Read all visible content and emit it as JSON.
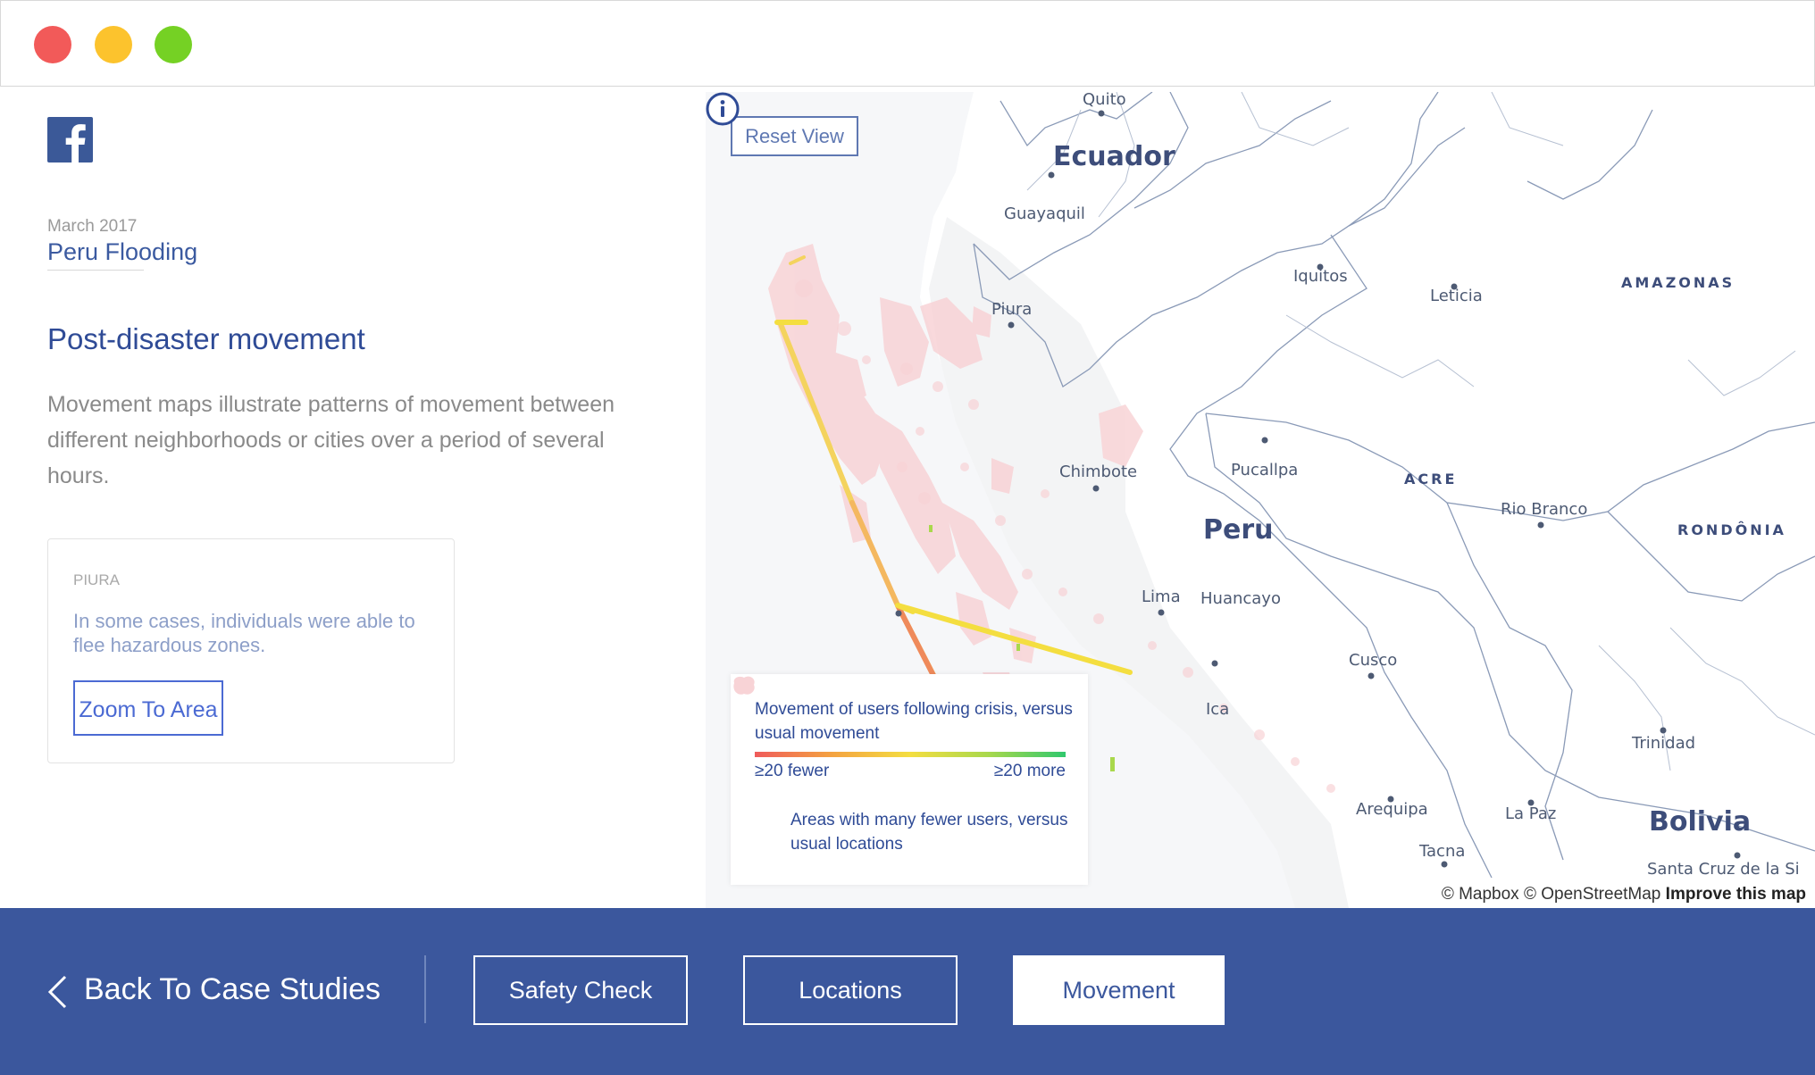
{
  "window": {
    "controls": [
      "close",
      "minimize",
      "maximize"
    ]
  },
  "sidebar": {
    "logo": "facebook-logo",
    "date": "March 2017",
    "event": "Peru Flooding",
    "section_title": "Post-disaster movement",
    "description": "Movement maps illustrate patterns of movement between different neighborhoods or cities over a period of several hours.",
    "card": {
      "kicker": "PIURA",
      "text": "In some cases, individuals were able to flee hazardous zones.",
      "button": "Zoom To Area"
    }
  },
  "map": {
    "reset_label": "Reset View",
    "info_icon": "info-icon",
    "labels": {
      "quito": "Quito",
      "ecuador": "Ecuador",
      "guayaquil": "Guayaquil",
      "iquitos": "Iquitos",
      "leticia": "Leticia",
      "amazonas": "AMAZONAS",
      "piura": "Piura",
      "chimbote": "Chimbote",
      "pucallpa": "Pucallpa",
      "acre": "ACRE",
      "rio_branco": "Rio Branco",
      "rondonia": "RONDÔNIA",
      "peru": "Peru",
      "lima": "Lima",
      "huancayo": "Huancayo",
      "cusco": "Cusco",
      "ica": "Ica",
      "trinidad": "Trinidad",
      "arequipa": "Arequipa",
      "la_paz": "La Paz",
      "bolivia": "Bolivia",
      "tacna": "Tacna",
      "santa_cruz": "Santa Cruz de la Si"
    },
    "legend": {
      "title": "Movement of users following crisis, versus usual movement",
      "left": "≥20 fewer",
      "right": "≥20 more",
      "areas": "Areas with many fewer users, versus usual locations",
      "colors": [
        "#ef5b5b",
        "#f4a340",
        "#f4de40",
        "#a9d84c",
        "#30c86d"
      ]
    },
    "attribution": {
      "mapbox": "© Mapbox",
      "osm": "© OpenStreetMap",
      "improve": "Improve this map"
    }
  },
  "bottom_nav": {
    "back_label": "Back To Case Studies",
    "tabs": [
      {
        "label": "Safety Check",
        "active": false
      },
      {
        "label": "Locations",
        "active": false
      },
      {
        "label": "Movement",
        "active": true
      }
    ],
    "colors": {
      "bar": "#3b579d",
      "accent": "#ffffff"
    }
  }
}
